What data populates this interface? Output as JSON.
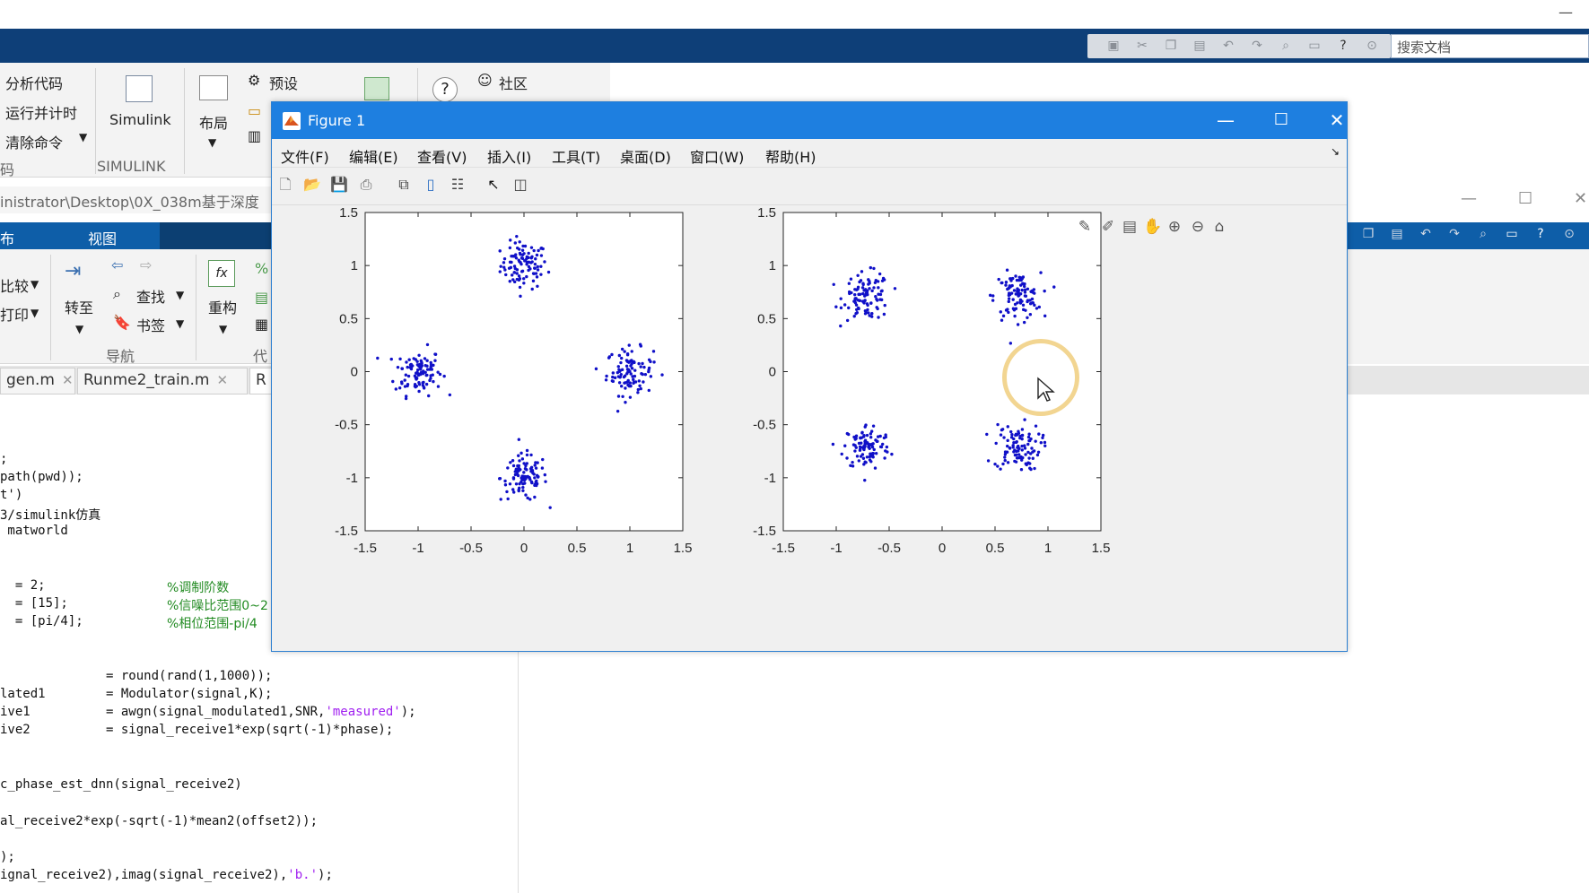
{
  "top": {
    "search_placeholder": "搜索文档"
  },
  "ribbon": {
    "analyze_code": "分析代码",
    "run_time": "运行并计时",
    "clear_commands": "清除命令",
    "code_group": "码",
    "simulink": "Simulink",
    "simulink_group": "SIMULINK",
    "layout": "布局",
    "preferences": "预设",
    "community": "社区"
  },
  "path": {
    "text": "inistrator\\Desktop\\0X_038m基于深度"
  },
  "editor_tabs": {
    "publish": "布",
    "view": "视图"
  },
  "editor_ribbon": {
    "compare": "比较",
    "print": "打印",
    "goto": "转至",
    "find": "查找",
    "bookmark": "书签",
    "refactor": "重构",
    "navigate_group": "导航",
    "code_group": "代"
  },
  "file_tabs": [
    {
      "label": "gen.m"
    },
    {
      "label": "Runme2_train.m"
    },
    {
      "label": "R"
    }
  ],
  "code": {
    "l1": ";",
    "l2": "path(pwd));",
    "l3": "t')",
    "l4": "3/simulink仿真",
    "l5": " matworld",
    "l6": "  = 2;",
    "l6c": "%调制阶数",
    "l7": "  = [15];",
    "l7c": "%信噪比范围0~2",
    "l8": "  = [pi/4];",
    "l8c": "%相位范围-pi/4",
    "l9": "              = round(rand(1,1000));",
    "l10": "lated1        = Modulator(signal,K);",
    "l11a": "ive1          = awgn(signal_modulated1,SNR,",
    "l11s": "'measured'",
    "l11b": ");",
    "l12": "ive2          = signal_receive1*exp(sqrt(-1)*phase);",
    "l13": "c_phase_est_dnn(signal_receive2)",
    "l14": "al_receive2*exp(-sqrt(-1)*mean2(offset2));",
    "l15": ");",
    "l16a": "ignal_receive2),imag(signal_receive2),",
    "l16s": "'b.'",
    "l16b": ");"
  },
  "figure": {
    "title": "Figure 1",
    "menus": [
      "文件(F)",
      "编辑(E)",
      "查看(V)",
      "插入(I)",
      "工具(T)",
      "桌面(D)",
      "窗口(W)",
      "帮助(H)"
    ]
  },
  "chart_data": [
    {
      "type": "scatter",
      "title": "",
      "xlabel": "",
      "ylabel": "",
      "xlim": [
        -1.5,
        1.5
      ],
      "ylim": [
        -1.5,
        1.5
      ],
      "xticks": [
        "-1.5",
        "-1",
        "-0.5",
        "0",
        "0.5",
        "1",
        "1.5"
      ],
      "yticks": [
        "1.5",
        "1",
        "0.5",
        "0",
        "-0.5",
        "-1",
        "-1.5"
      ],
      "marker_color": "#1010c8",
      "clusters": [
        {
          "center": [
            0,
            1
          ],
          "spread": 0.11,
          "n": 100
        },
        {
          "center": [
            -1,
            0
          ],
          "spread": 0.11,
          "n": 100
        },
        {
          "center": [
            1,
            0
          ],
          "spread": 0.11,
          "n": 100
        },
        {
          "center": [
            0,
            -1
          ],
          "spread": 0.11,
          "n": 100
        }
      ]
    },
    {
      "type": "scatter",
      "title": "",
      "xlabel": "",
      "ylabel": "",
      "xlim": [
        -1.5,
        1.5
      ],
      "ylim": [
        -1.5,
        1.5
      ],
      "xticks": [
        "-1.5",
        "-1",
        "-0.5",
        "0",
        "0.5",
        "1",
        "1.5"
      ],
      "yticks": [
        "1.5",
        "1",
        "0.5",
        "0",
        "-0.5",
        "-1",
        "-1.5"
      ],
      "marker_color": "#1010c8",
      "clusters": [
        {
          "center": [
            -0.71,
            0.71
          ],
          "spread": 0.11,
          "n": 100
        },
        {
          "center": [
            0.71,
            0.71
          ],
          "spread": 0.11,
          "n": 100
        },
        {
          "center": [
            -0.71,
            -0.71
          ],
          "spread": 0.11,
          "n": 100
        },
        {
          "center": [
            0.71,
            -0.71
          ],
          "spread": 0.11,
          "n": 100
        }
      ]
    }
  ]
}
